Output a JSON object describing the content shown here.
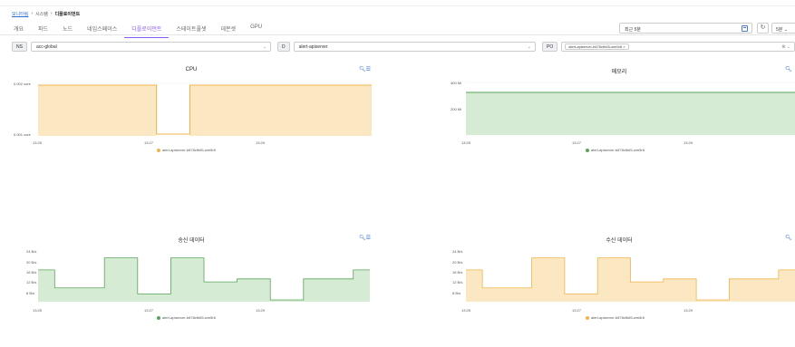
{
  "breadcrumb": {
    "root": "모니터링",
    "mid": "시스템",
    "current": "디플로이먼트"
  },
  "tabs": [
    {
      "label": "개요"
    },
    {
      "label": "파드"
    },
    {
      "label": "노드"
    },
    {
      "label": "네임스페이스"
    },
    {
      "label": "디플로이먼트",
      "active": true
    },
    {
      "label": "스테이트풀셋"
    },
    {
      "label": "데몬셋"
    },
    {
      "label": "GPU"
    }
  ],
  "time_range": "최근 5분",
  "refresh_icon": "refresh-icon",
  "interval": "5분",
  "filters": {
    "ns": {
      "badge": "NS",
      "value": "acc-global"
    },
    "d": {
      "badge": "D",
      "value": "alert-apiserver"
    },
    "po": {
      "badge": "PO",
      "value": "alert-apiserver-b878cfb65-wm5r6 ×"
    }
  },
  "colors": {
    "orange_line": "#f0b44a",
    "orange_fill": "#fbe8c2",
    "green_line": "#5aa45a",
    "green_fill": "#d6ebd4",
    "accent": "#8b5cf6"
  },
  "legend_label": "alert-apiserver-b878cfb65-wm5r6",
  "charts": [
    {
      "title": "CPU",
      "y_ticks": [
        "0.002 core",
        "0.001 core"
      ],
      "x_ticks": [
        "13:25",
        "13:27",
        "13:29"
      ],
      "legend": "alert-apiserver-b878cfb65-wm5r6",
      "chart_data": {
        "type": "area",
        "series": [
          {
            "name": "alert-apiserver-b878cfb65-wm5r6",
            "x": [
              "13:25",
              "13:26.5",
              "13:26.5",
              "13:27.2",
              "13:27.2",
              "13:29.5"
            ],
            "y": [
              0.002,
              0.002,
              0.001,
              0.001,
              0.002,
              0.002
            ]
          }
        ]
      }
    },
    {
      "title": "메모리",
      "y_ticks": [
        "400 Mi",
        "200 Mi"
      ],
      "x_ticks": [
        "13:25",
        "13:27",
        "13:29"
      ],
      "legend": "alert-apiserver-b878cfb65-wm5r6",
      "chart_data": {
        "type": "area",
        "series": [
          {
            "name": "alert-apiserver-b878cfb65-wm5r6",
            "x": [
              "13:25",
              "13:30"
            ],
            "y": [
              320,
              320
            ]
          }
        ]
      }
    },
    {
      "title": "송신 데이터",
      "y_ticks": [
        "24 B/s",
        "20 B/s",
        "16 B/s",
        "12 B/s",
        "8 B/s"
      ],
      "x_ticks": [
        "13:25",
        "13:27",
        "13:29"
      ],
      "legend": "alert-apiserver-b878cfb65-wm5r6",
      "chart_data": {
        "type": "area",
        "series": [
          {
            "name": "alert-apiserver-b878cfb65-wm5r6",
            "values": [
              18,
              12,
              12,
              12,
              22,
              22,
              10,
              10,
              22,
              22,
              14,
              14,
              15,
              15,
              8,
              8,
              15,
              15,
              15,
              18,
              18
            ]
          }
        ]
      }
    },
    {
      "title": "수신 데이터",
      "y_ticks": [
        "24 B/s",
        "20 B/s",
        "16 B/s",
        "12 B/s",
        "8 B/s"
      ],
      "x_ticks": [
        "13:25",
        "13:27",
        "13:29"
      ],
      "legend": "alert-apiserver-b878cfb65-wm5r6",
      "chart_data": {
        "type": "area",
        "series": [
          {
            "name": "alert-apiserver-b878cfb65-wm5r6",
            "values": [
              18,
              12,
              12,
              12,
              22,
              22,
              10,
              10,
              22,
              22,
              14,
              14,
              15,
              15,
              8,
              8,
              15,
              15,
              15,
              18,
              18
            ]
          }
        ]
      }
    }
  ]
}
